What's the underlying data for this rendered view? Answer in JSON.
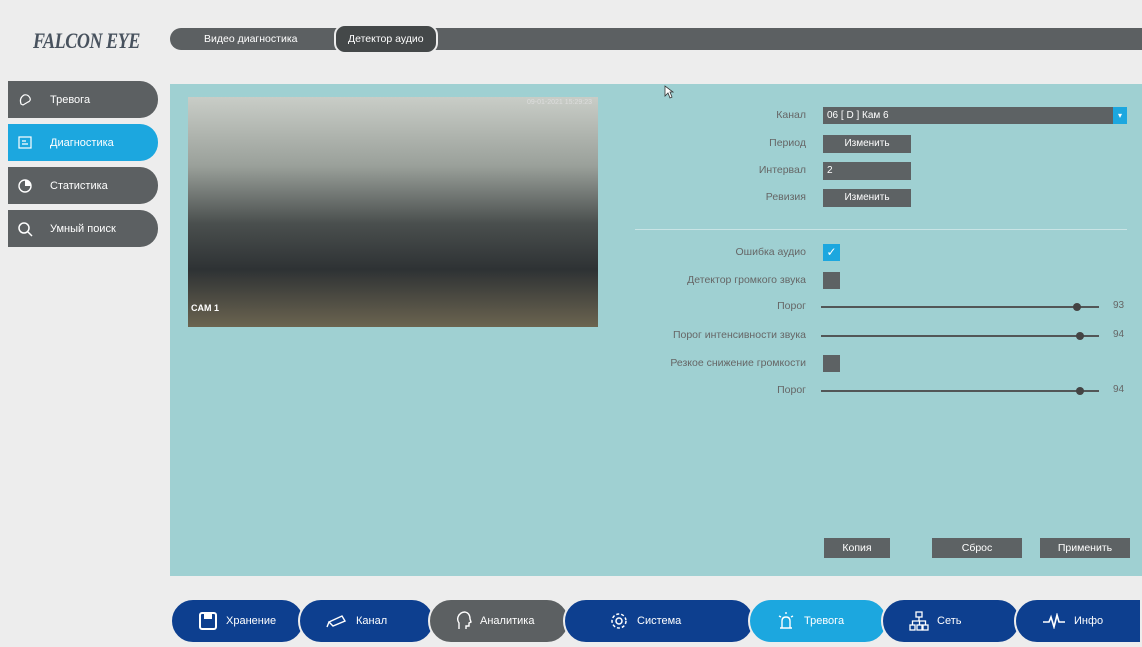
{
  "brand": {
    "logo": "FALCON EYE"
  },
  "top_tabs": [
    {
      "label": "Видео диагностика"
    },
    {
      "label": "Детектор аудио"
    }
  ],
  "sidebar": {
    "items": [
      {
        "label": "Тревога",
        "icon": "alarm-icon"
      },
      {
        "label": "Диагностика",
        "icon": "diagnostics-icon",
        "active": true
      },
      {
        "label": "Статистика",
        "icon": "pie-chart-icon"
      },
      {
        "label": "Умный поиск",
        "icon": "search-icon"
      }
    ]
  },
  "preview": {
    "cam_label": "CAM 1",
    "timestamp": "09-01-2021 15:29:23"
  },
  "form": {
    "channel_label": "Канал",
    "channel_value": "06 [ D ] Кам 6",
    "period_label": "Период",
    "period_button": "Изменить",
    "interval_label": "Интервал",
    "interval_value": "2",
    "revision_label": "Ревизия",
    "revision_button": "Изменить",
    "audio_error_label": "Ошибка аудио",
    "audio_error_checked": true,
    "loud_detector_label": "Детектор громкого звука",
    "loud_detector_checked": false,
    "threshold1_label": "Порог",
    "threshold1_value": "93",
    "intensity_label": "Порог интенсивности звука",
    "intensity_value": "94",
    "drop_label": "Резкое снижение громкости",
    "drop_checked": false,
    "threshold2_label": "Порог",
    "threshold2_value": "94"
  },
  "actions": {
    "copy": "Копия",
    "reset": "Сброс",
    "apply": "Применить"
  },
  "bottom_nav": [
    {
      "label": "Хранение",
      "icon": "save-icon"
    },
    {
      "label": "Канал",
      "icon": "camera-icon"
    },
    {
      "label": "Аналитика",
      "icon": "head-icon"
    },
    {
      "label": "Система",
      "icon": "gear-icon"
    },
    {
      "label": "Тревога",
      "icon": "alarm-light-icon"
    },
    {
      "label": "Сеть",
      "icon": "network-icon"
    },
    {
      "label": "Инфо",
      "icon": "pulse-icon"
    }
  ],
  "colors": {
    "accent": "#1ca7df",
    "panel": "#9fd0d2",
    "nav_blue": "#0d3f8f",
    "dark": "#5c6062"
  }
}
